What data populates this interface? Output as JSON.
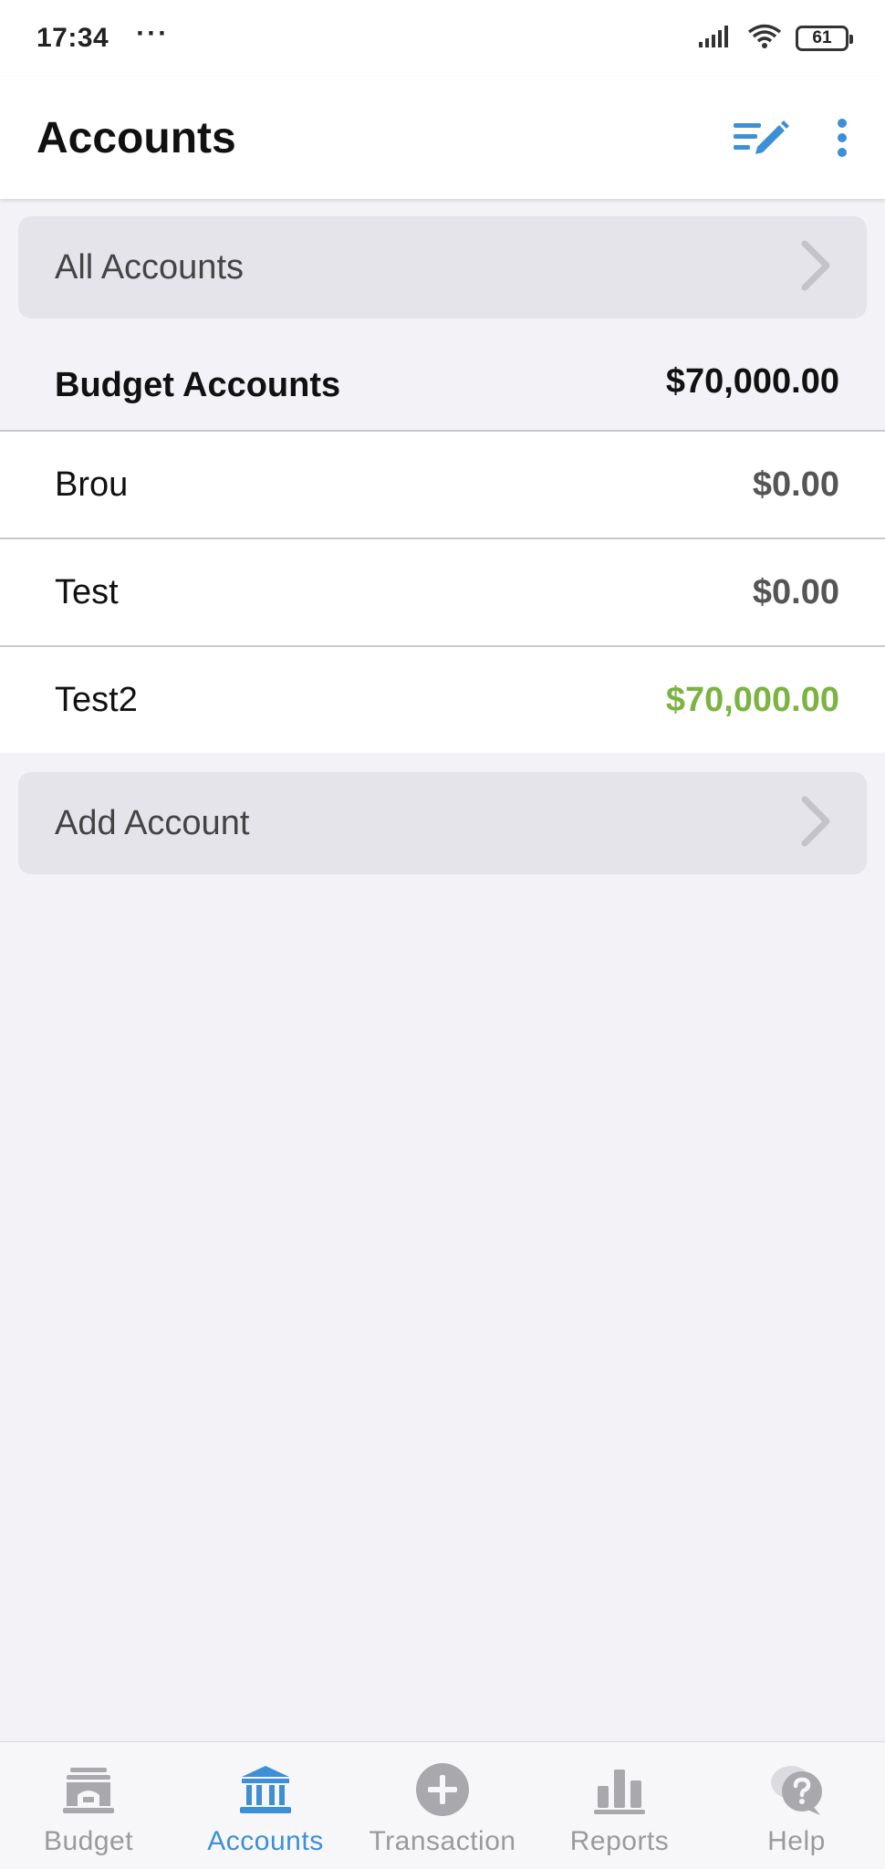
{
  "status_bar": {
    "time": "17:34",
    "dots": "···",
    "battery": "61",
    "icons": [
      "signal-icon",
      "wifi-icon",
      "battery-icon"
    ]
  },
  "header": {
    "title": "Accounts",
    "actions": [
      "edit-list-icon",
      "more-vert-icon"
    ]
  },
  "all_accounts": {
    "label": "All Accounts"
  },
  "budget_group": {
    "title": "Budget Accounts",
    "total": "$70,000.00"
  },
  "accounts": [
    {
      "name": "Brou",
      "balance": "$0.00"
    },
    {
      "name": "Test",
      "balance": "$0.00"
    },
    {
      "name": "Test2",
      "balance": "$70,000.00"
    }
  ],
  "add_account": {
    "label": "Add Account"
  },
  "bottom_nav": {
    "active": "Accounts",
    "tabs": [
      {
        "label": "Budget",
        "icon": "budget-icon"
      },
      {
        "label": "Accounts",
        "icon": "bank-icon"
      },
      {
        "label": "Transaction",
        "icon": "add-circle-icon"
      },
      {
        "label": "Reports",
        "icon": "bar-chart-icon"
      },
      {
        "label": "Help",
        "icon": "help-icon"
      }
    ]
  },
  "colors": {
    "accent": "#3d8fd6",
    "positive": "#7cb342",
    "background": "#f2f2f7",
    "card": "#e4e4ea"
  }
}
